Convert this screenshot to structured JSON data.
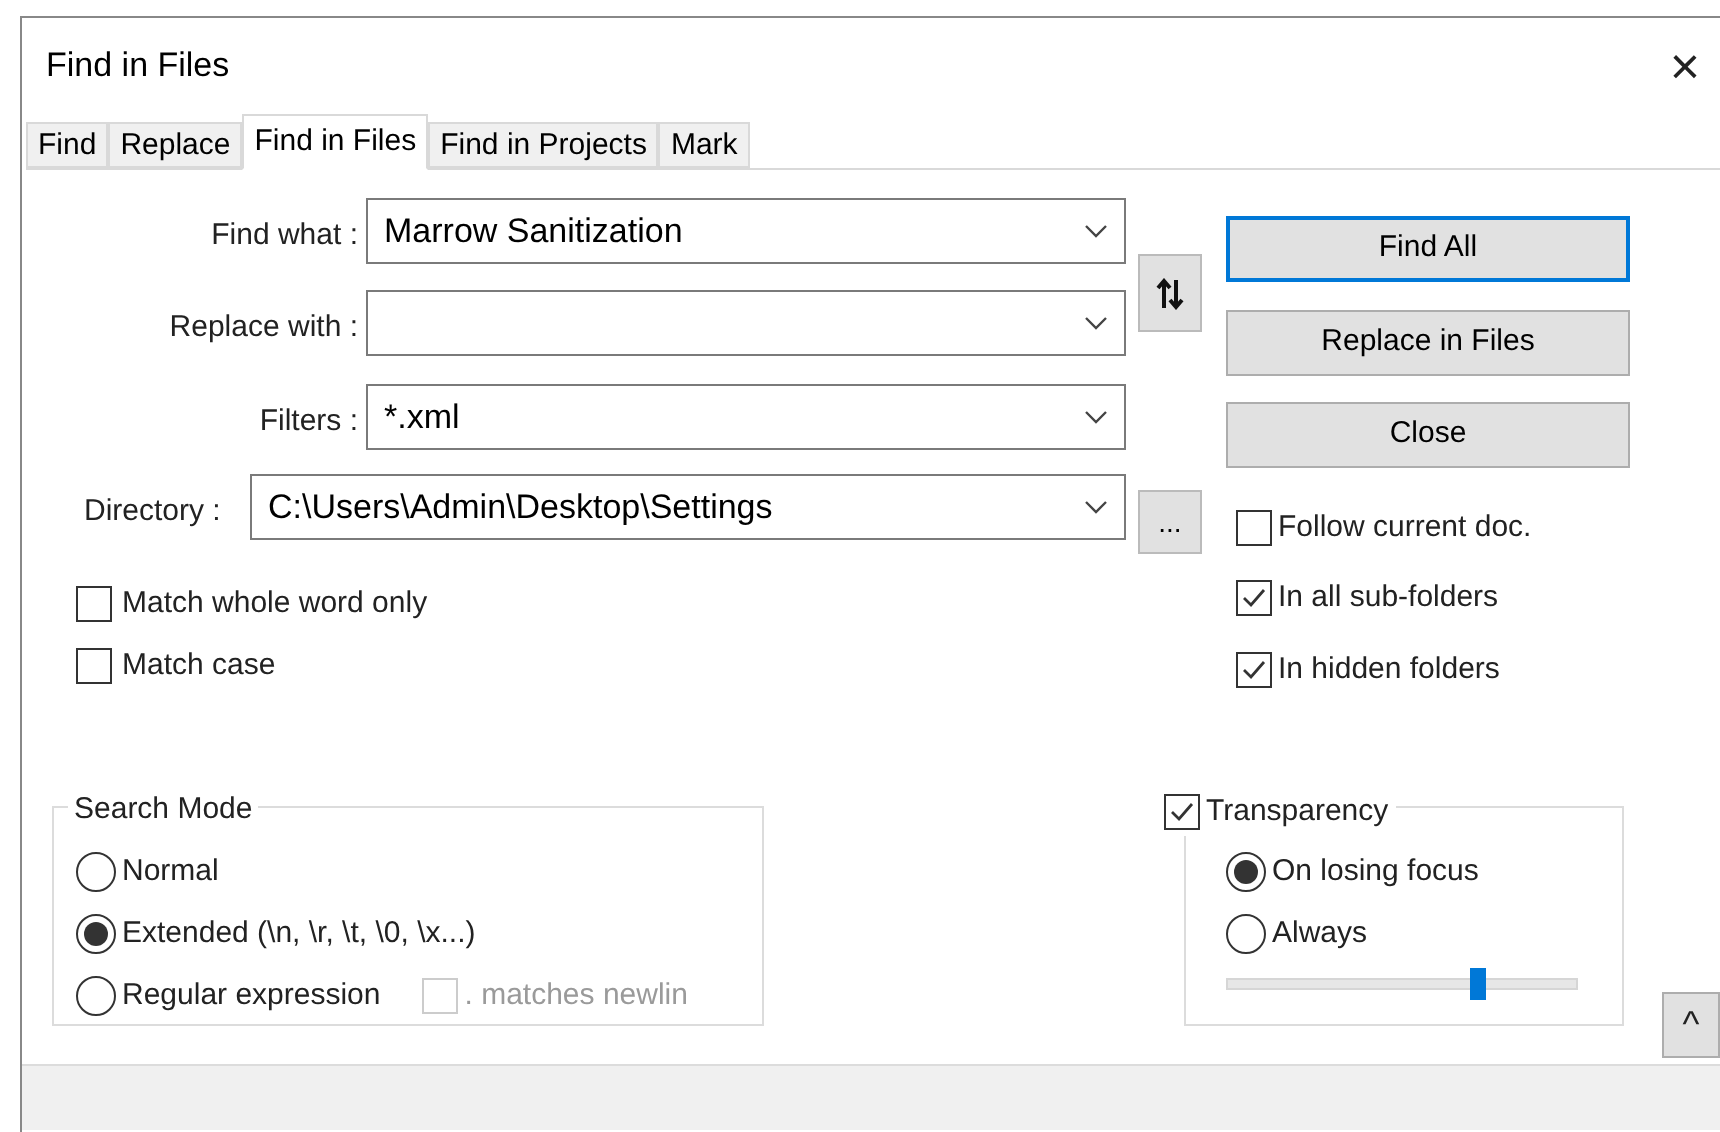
{
  "window": {
    "title": "Find in Files",
    "close": "×"
  },
  "tabs": [
    {
      "label": "Find",
      "selected": false
    },
    {
      "label": "Replace",
      "selected": false
    },
    {
      "label": "Find in Files",
      "selected": true
    },
    {
      "label": "Find in Projects",
      "selected": false
    },
    {
      "label": "Mark",
      "selected": false
    }
  ],
  "fields": [
    {
      "label": "Find what :",
      "value": "Marrow Sanitization"
    },
    {
      "label": "Replace with :"
    },
    {
      "label": "Filters :",
      "value": "*.xml"
    },
    {
      "label": "Directory :",
      "value": "C:\\Users\\Admin\\Desktop\\Settings"
    }
  ],
  "browse_button": "...",
  "buttons": [
    {
      "label": "Find All",
      "focused": true
    },
    {
      "label": "Replace in Files",
      "focused": false
    },
    {
      "label": "Close",
      "focused": false
    }
  ],
  "right_options": [
    {
      "label": "Follow current doc.",
      "checked": false
    },
    {
      "label": "In all sub-folders",
      "checked": true
    },
    {
      "label": "In hidden folders",
      "checked": true
    }
  ],
  "left_options": [
    {
      "label": "Match whole word only",
      "checked": false
    },
    {
      "label": "Match case",
      "checked": false
    }
  ],
  "search_mode": {
    "title": "Search Mode",
    "options": [
      {
        "label": "Normal",
        "selected": false
      },
      {
        "label": "Extended (\\n, \\r, \\t, \\0, \\x...)",
        "selected": true
      },
      {
        "label": "Regular expression",
        "selected": false
      }
    ],
    "newline_option": {
      "label": ". matches newlin",
      "checked": false,
      "disabled": true
    }
  },
  "transparency": {
    "label": "Transparency",
    "checked": true,
    "options": [
      {
        "label": "On losing focus",
        "selected": true
      },
      {
        "label": "Always",
        "selected": false
      }
    ],
    "level": 0.71
  },
  "collapse_button": "^"
}
